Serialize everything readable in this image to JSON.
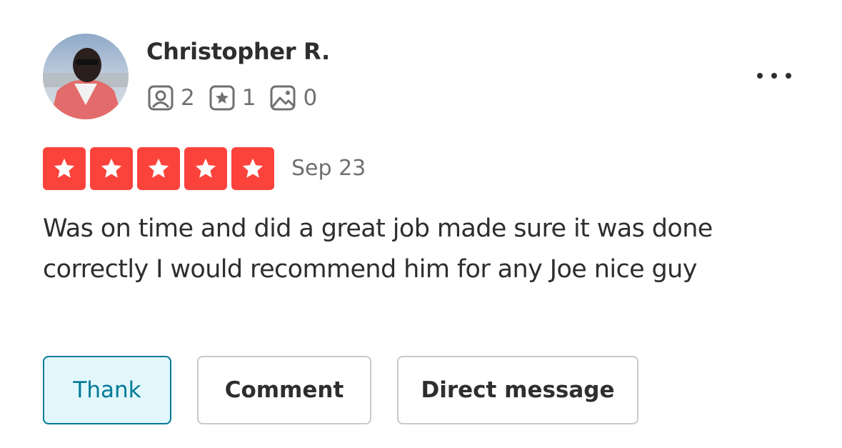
{
  "review": {
    "user": {
      "name": "Christopher R.",
      "avatar_icon": "user-avatar-photo",
      "stats": {
        "friends": "2",
        "reviews": "1",
        "photos": "0"
      }
    },
    "menu_icon": "more-options-icon",
    "rating": 5,
    "rating_color": "#fb433c",
    "date": "Sep 23",
    "text": "Was on time and did a great job made sure it was done correctly I would recommend him for any Joe nice guy"
  },
  "actions": {
    "thank_label": "Thank",
    "comment_label": "Comment",
    "direct_message_label": "Direct message"
  },
  "colors": {
    "accent": "#027a97",
    "accent_bg": "#e1f7fc",
    "star_bg": "#fb433c",
    "text": "#2d2e2f",
    "muted": "#6e7072"
  }
}
